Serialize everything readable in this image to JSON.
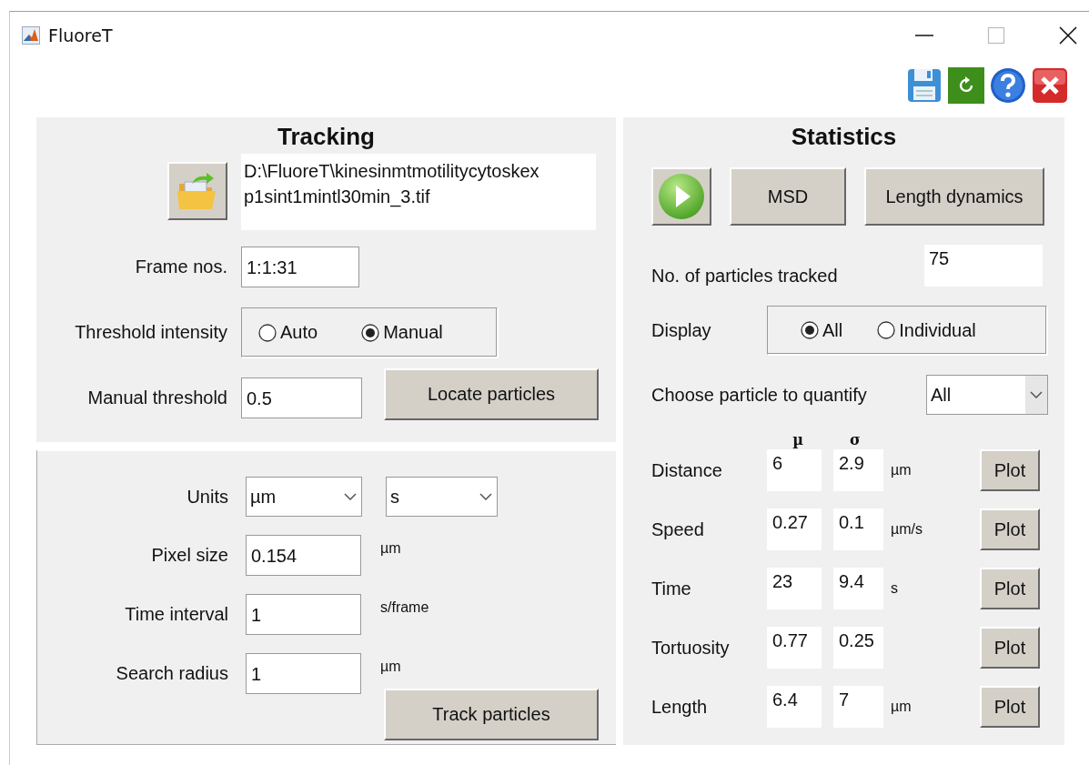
{
  "window": {
    "title": "FluoreT"
  },
  "tracking": {
    "title": "Tracking",
    "file_path_lines": [
      "D:\\FluoreT\\kinesinmtmotilitycytoskex",
      "p1sint1mintl30min_3.tif"
    ],
    "frame_nos": {
      "label": "Frame nos.",
      "value": "1:1:31"
    },
    "threshold_intensity": {
      "label": "Threshold intensity",
      "options": [
        {
          "label": "Auto",
          "selected": false
        },
        {
          "label": "Manual",
          "selected": true
        }
      ]
    },
    "manual_threshold": {
      "label": "Manual threshold",
      "value": "0.5"
    },
    "locate_button": "Locate particles"
  },
  "parameters": {
    "units": {
      "label": "Units",
      "length_unit": "µm",
      "time_unit": "s"
    },
    "fields": [
      {
        "label": "Pixel size",
        "value": "0.154",
        "unit": "µm"
      },
      {
        "label": "Time interval",
        "value": "1",
        "unit": "s/frame"
      },
      {
        "label": "Search radius",
        "value": "1",
        "unit": "µm"
      }
    ],
    "track_button": "Track particles"
  },
  "statistics": {
    "title": "Statistics",
    "buttons": [
      "MSD",
      "Length dynamics"
    ],
    "particles_tracked": {
      "label": "No. of particles tracked",
      "value": "75"
    },
    "display": {
      "label": "Display",
      "options": [
        {
          "label": "All",
          "selected": true
        },
        {
          "label": "Individual",
          "selected": false
        }
      ]
    },
    "choose_particle": {
      "label": "Choose particle to quantify",
      "value": "All"
    },
    "headers": [
      "µ",
      "σ"
    ],
    "rows": [
      {
        "label": "Distance",
        "mean": "6",
        "sd": "2.9",
        "unit": "µm",
        "button": "Plot"
      },
      {
        "label": "Speed",
        "mean": "0.27",
        "sd": "0.1",
        "unit": "µm/s",
        "button": "Plot"
      },
      {
        "label": "Time",
        "mean": "23",
        "sd": "9.4",
        "unit": "s",
        "button": "Plot"
      },
      {
        "label": "Tortuosity",
        "mean": "0.77",
        "sd": "0.25",
        "button": "Plot"
      },
      {
        "label": "Length",
        "mean": "6.4",
        "sd": "7",
        "unit": "µm",
        "button": "Plot"
      }
    ]
  }
}
